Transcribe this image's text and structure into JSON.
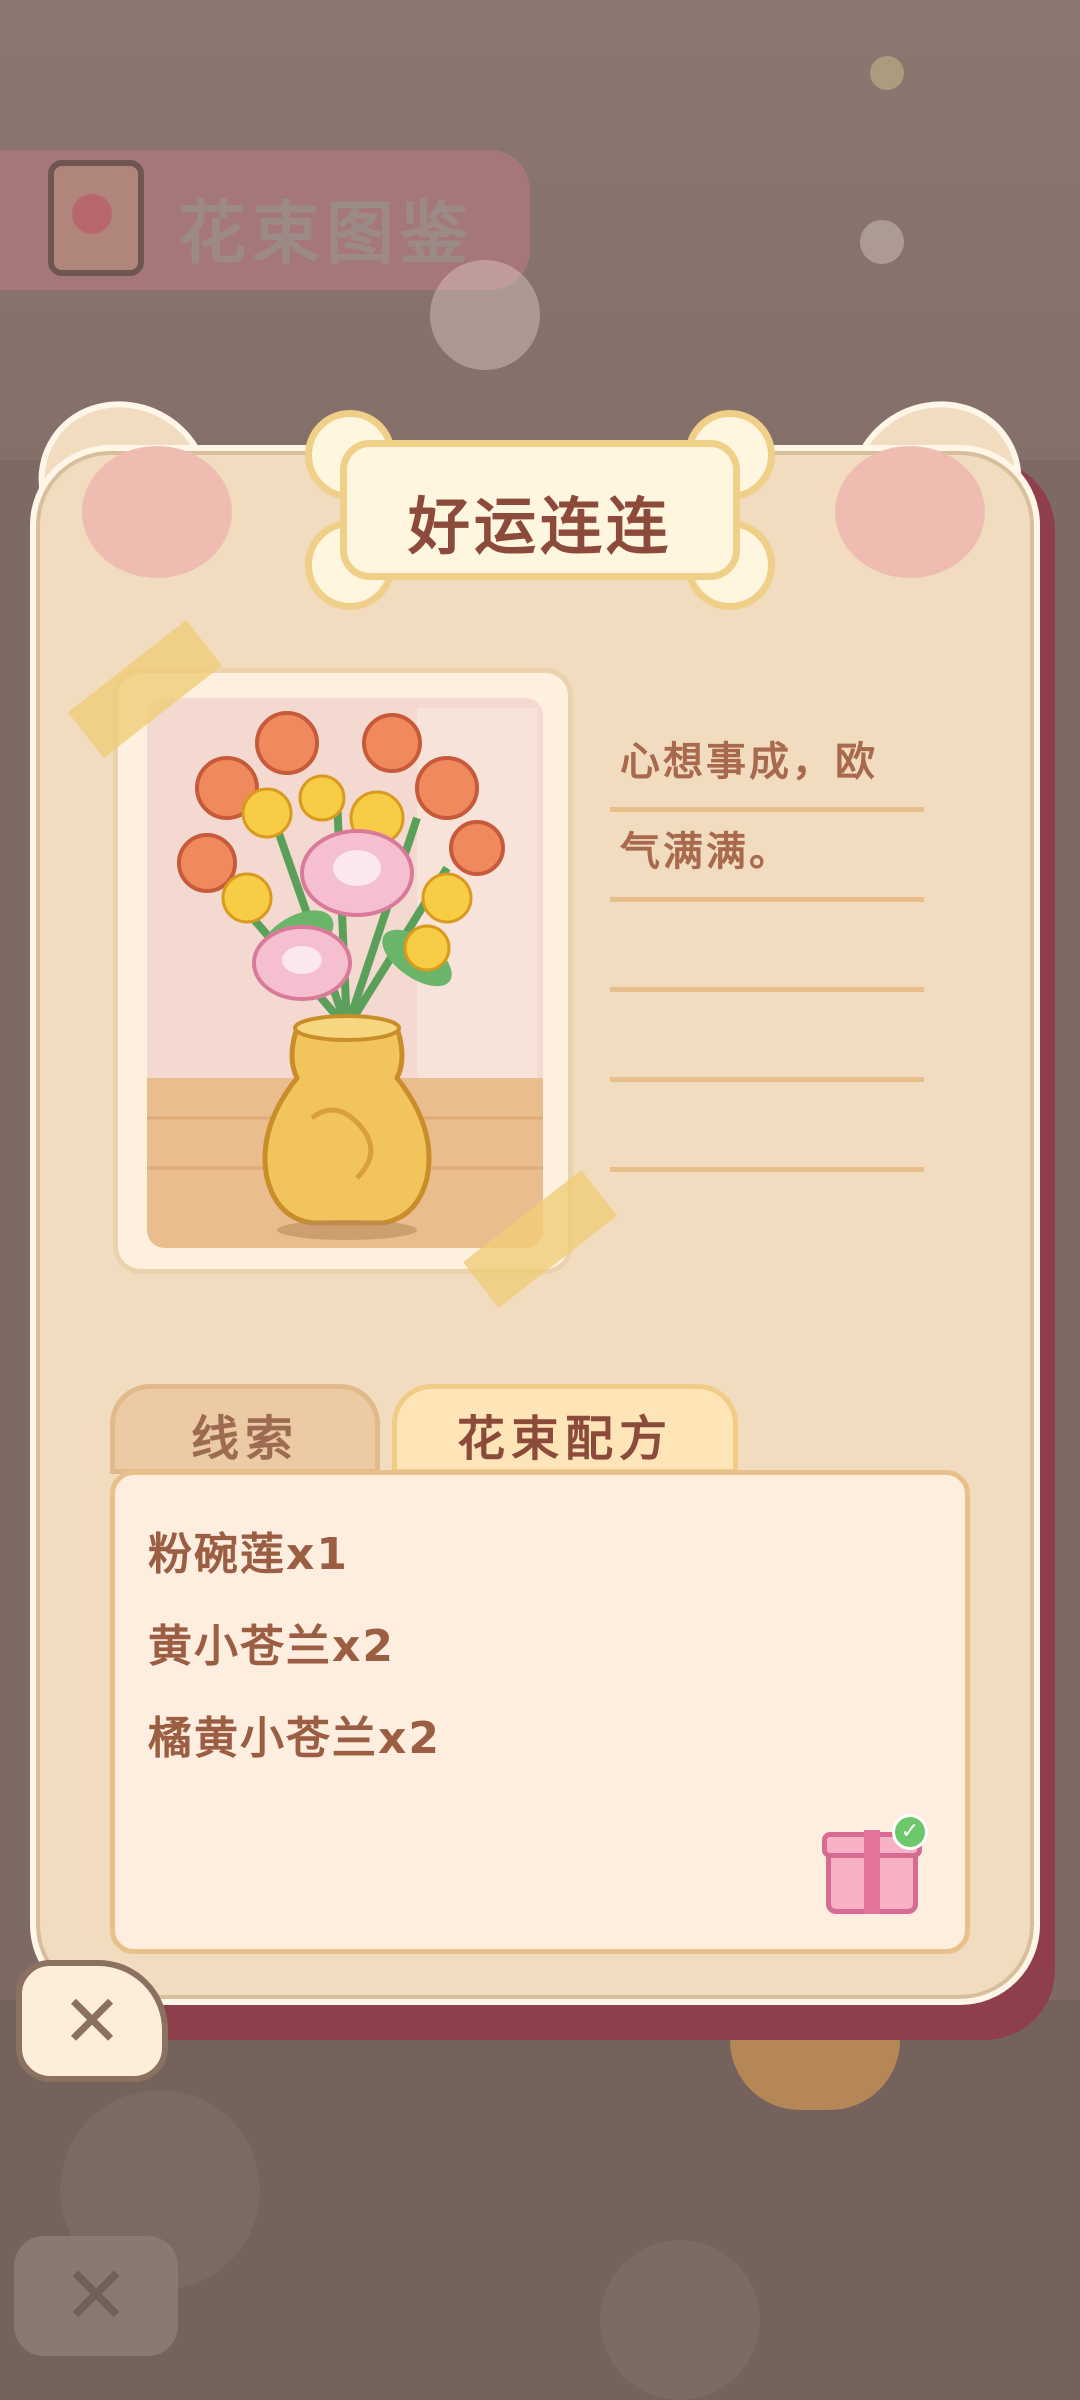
{
  "background": {
    "title": "花束图鉴",
    "book_icon": "album-book-icon",
    "close_icon": "close-icon"
  },
  "card": {
    "title": "好运连连",
    "description_lines": [
      "心想事成，欧",
      "气满满。",
      "",
      "",
      ""
    ],
    "image": "bouquet-in-golden-vase"
  },
  "tabs": [
    {
      "label": "线索",
      "active": false
    },
    {
      "label": "花束配方",
      "active": true
    }
  ],
  "recipe": [
    "粉碗莲x1",
    "黄小苍兰x2",
    "橘黄小苍兰x2"
  ],
  "gift": {
    "icon": "gift-box-icon",
    "claimed": true
  },
  "close_button": {
    "icon": "close-icon"
  },
  "colors": {
    "title_text": "#8c4b3a",
    "card_bg": "#f1dcc0",
    "accent_gold": "#f0cf89",
    "shadow_red": "#8e3f4b"
  }
}
